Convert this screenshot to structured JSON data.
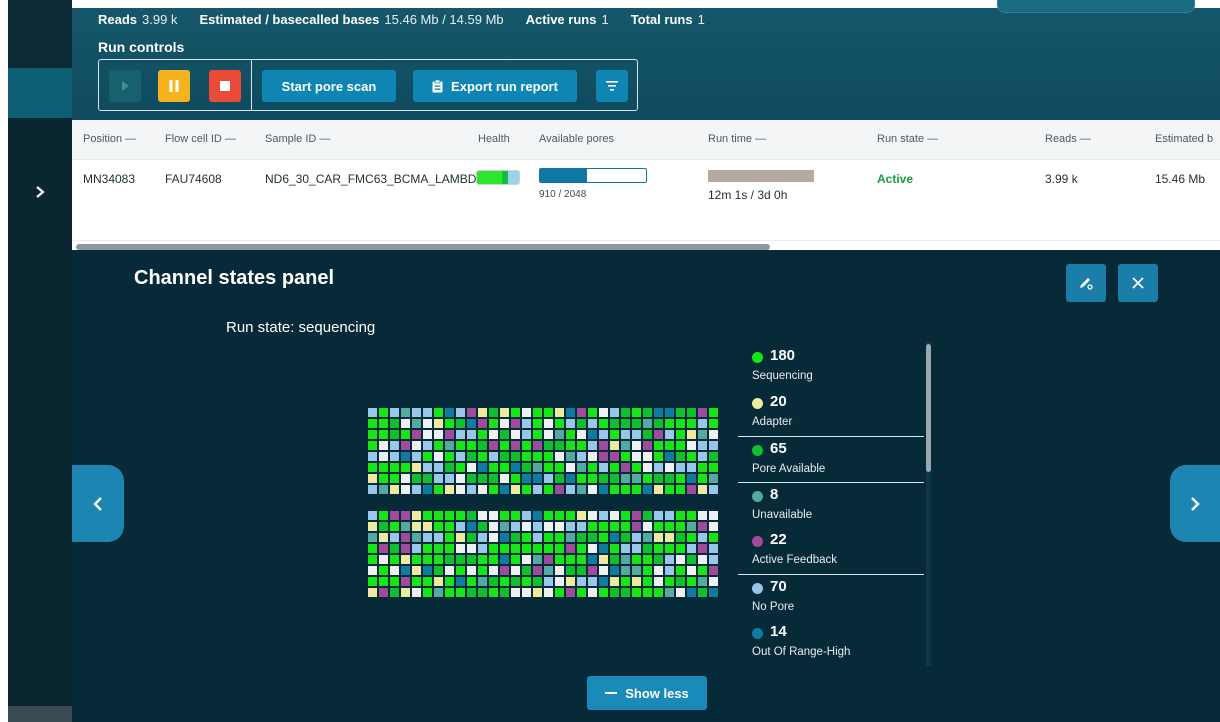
{
  "stats": [
    {
      "label": "Reads",
      "value": "3.99 k"
    },
    {
      "label": "Estimated / basecalled bases",
      "value": "15.46 Mb / 14.59 Mb"
    },
    {
      "label": "Active runs",
      "value": "1"
    },
    {
      "label": "Total runs",
      "value": "1"
    }
  ],
  "run_controls": {
    "title": "Run controls",
    "start_pore_scan": "Start pore scan",
    "export_run_report": "Export run report"
  },
  "table": {
    "columns": [
      "Position —",
      "Flow cell ID —",
      "Sample ID —",
      "Health",
      "Available pores",
      "Run time —",
      "Run state —",
      "Reads —",
      "Estimated b"
    ],
    "row": {
      "position": "MN34083",
      "flow_cell_id": "FAU74608",
      "sample_id": "ND6_30_CAR_FMC63_BCMA_LAMBDA",
      "available_pores_text": "910 / 2048",
      "available_pores_fraction": 0.444,
      "run_time_text": "12m 1s / 3d 0h",
      "run_time_fraction": 1.0,
      "run_state": "Active",
      "reads": "3.99 k",
      "estimated": "15.46 Mb"
    }
  },
  "panel": {
    "title": "Channel states panel",
    "run_state_line": "Run state: sequencing",
    "show_less": "Show less"
  },
  "legend": [
    {
      "count": "180",
      "label": "Sequencing",
      "color": "#16e616",
      "separator": false
    },
    {
      "count": "20",
      "label": "Adapter",
      "color": "#eeeba0",
      "separator": false
    },
    {
      "count": "65",
      "label": "Pore Available",
      "color": "#0fbf2e",
      "separator": true
    },
    {
      "count": "8",
      "label": "Unavailable",
      "color": "#54a9a0",
      "separator": true
    },
    {
      "count": "22",
      "label": "Active Feedback",
      "color": "#a04a9c",
      "separator": false
    },
    {
      "count": "70",
      "label": "No Pore",
      "color": "#99c7ea",
      "separator": true
    },
    {
      "count": "14",
      "label": "Out Of Range-High",
      "color": "#0e7ba0",
      "separator": false
    }
  ],
  "grid_colors": {
    "sequencing": "#16e616",
    "adapter": "#eeeba0",
    "pore_available": "#0fbf2e",
    "unavailable": "#54a9a0",
    "active_feedback": "#a04a9c",
    "no_pore": "#99c7ea",
    "out_of_range_high": "#0e7ba0",
    "empty": "#eef1f2"
  }
}
